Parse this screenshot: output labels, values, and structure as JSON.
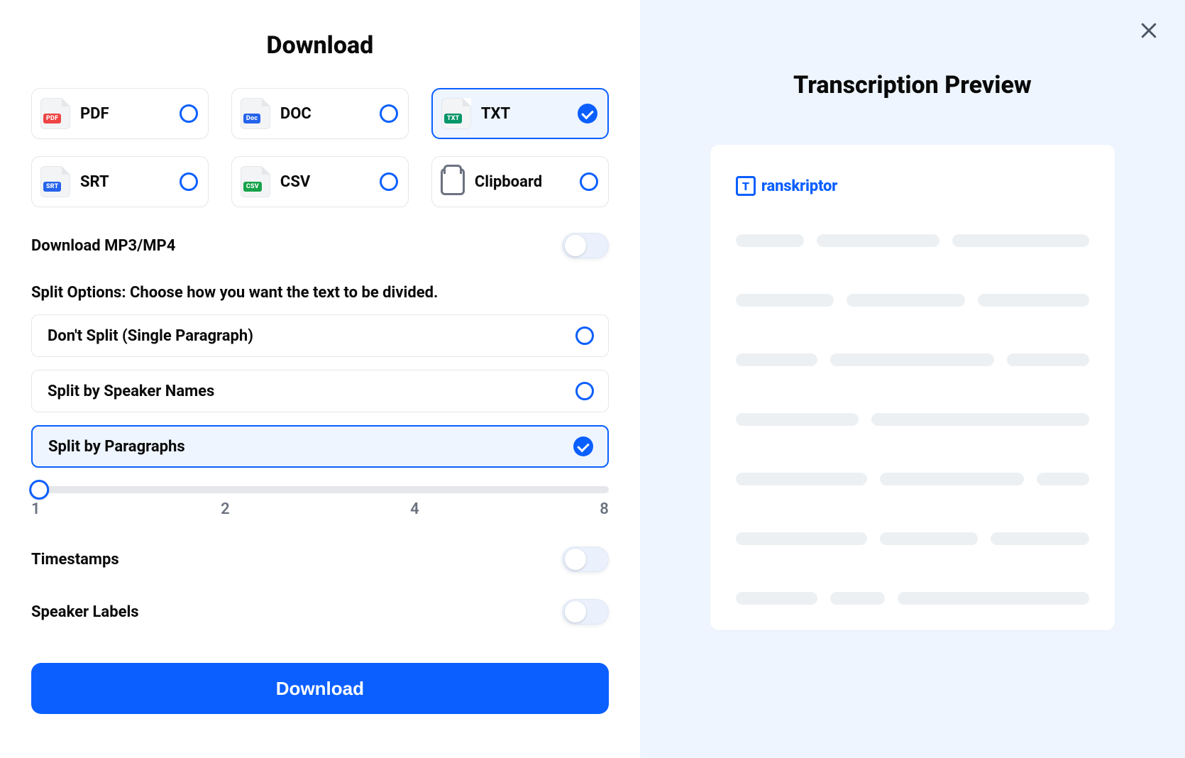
{
  "left": {
    "title": "Download",
    "formats": [
      {
        "key": "pdf",
        "label": "PDF",
        "badge": "PDF",
        "badge_class": "badge-pdf",
        "icon": "file",
        "selected": false
      },
      {
        "key": "doc",
        "label": "DOC",
        "badge": "Doc",
        "badge_class": "badge-doc",
        "icon": "file",
        "selected": false
      },
      {
        "key": "txt",
        "label": "TXT",
        "badge": "TXT",
        "badge_class": "badge-txt",
        "icon": "file",
        "selected": true
      },
      {
        "key": "srt",
        "label": "SRT",
        "badge": "SRT",
        "badge_class": "badge-srt",
        "icon": "file",
        "selected": false
      },
      {
        "key": "csv",
        "label": "CSV",
        "badge": "CSV",
        "badge_class": "badge-csv",
        "icon": "file",
        "selected": false
      },
      {
        "key": "clip",
        "label": "Clipboard",
        "badge": "",
        "badge_class": "",
        "icon": "clipboard",
        "selected": false
      }
    ],
    "download_media": {
      "label": "Download MP3/MP4",
      "value": false
    },
    "split_section_label": "Split Options: Choose how you want the text to be divided.",
    "split_options": [
      {
        "label": "Don't Split (Single Paragraph)",
        "selected": false
      },
      {
        "label": "Split by Speaker Names",
        "selected": false
      },
      {
        "label": "Split by Paragraphs",
        "selected": true
      }
    ],
    "slider": {
      "min": 1,
      "max": 8,
      "value": 1,
      "ticks": [
        "1",
        "2",
        "4",
        "8"
      ]
    },
    "toggles": [
      {
        "key": "timestamps",
        "label": "Timestamps",
        "value": false
      },
      {
        "key": "speaker_labels",
        "label": "Speaker Labels",
        "value": false
      }
    ],
    "primary_button": "Download"
  },
  "right": {
    "title": "Transcription Preview",
    "brand": "ranskriptor",
    "brand_initial": "T"
  }
}
